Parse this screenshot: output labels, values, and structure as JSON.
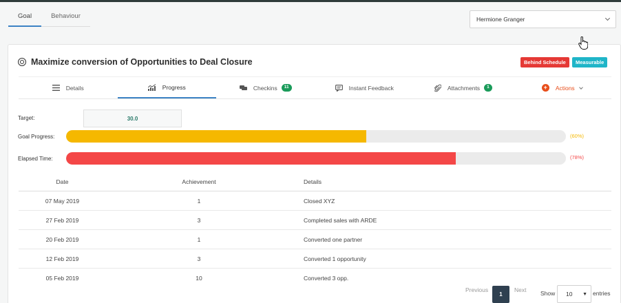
{
  "top_tabs": [
    {
      "label": "Goal",
      "active": true
    },
    {
      "label": "Behaviour",
      "active": false
    }
  ],
  "employee_select": {
    "value": "Hermione Granger"
  },
  "goal": {
    "title": "Maximize conversion of Opportunities to Deal Closure",
    "badges": {
      "status": "Behind Schedule",
      "type": "Measurable"
    }
  },
  "sub_tabs": {
    "details": "Details",
    "progress": "Progress",
    "checkins": "Checkins",
    "checkins_count": "11",
    "feedback": "Instant Feedback",
    "attachments": "Attachments",
    "attachments_count": "1",
    "actions": "Actions"
  },
  "target": {
    "label": "Target:",
    "value": "30.0"
  },
  "goal_progress": {
    "label": "Goal Progress:",
    "percent": 60,
    "text": "(60%)",
    "color": "#f5b800"
  },
  "elapsed_time": {
    "label": "Elapsed Time:",
    "percent": 78,
    "text": "(78%)",
    "color": "#f44747"
  },
  "table": {
    "headers": {
      "date": "Date",
      "achievement": "Achievement",
      "details": "Details"
    },
    "rows": [
      {
        "date": "07 May 2019",
        "achievement": "1",
        "details": "Closed XYZ"
      },
      {
        "date": "27 Feb 2019",
        "achievement": "3",
        "details": "Completed sales with ARDE"
      },
      {
        "date": "20 Feb 2019",
        "achievement": "1",
        "details": "Converted one partner"
      },
      {
        "date": "12 Feb 2019",
        "achievement": "3",
        "details": "Converted 1 opportunity"
      },
      {
        "date": "05 Feb 2019",
        "achievement": "10",
        "details": "Converted 3 opp."
      }
    ]
  },
  "pagination": {
    "previous": "Previous",
    "current_page": "1",
    "next": "Next",
    "show_label": "Show",
    "page_size": "10",
    "entries_label": "entries"
  },
  "colors": {
    "accent": "#3b82c4",
    "badge_red": "#e53935",
    "badge_cyan": "#1fb5c8",
    "count_green": "#1a9b5a",
    "actions_orange": "#e84e1b"
  }
}
